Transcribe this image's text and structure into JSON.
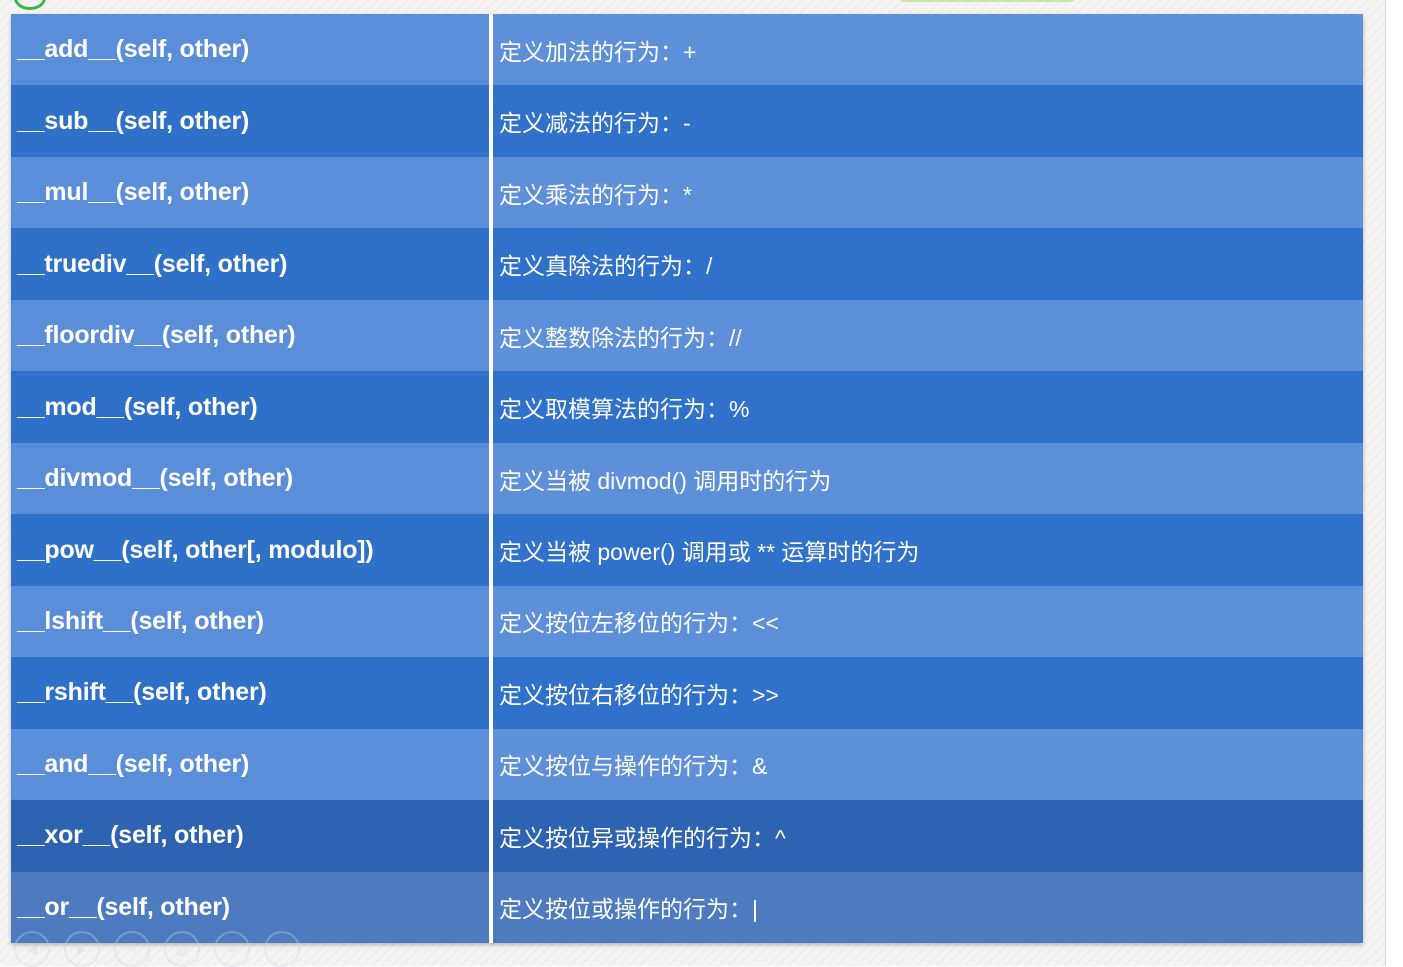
{
  "rows": [
    {
      "name": "__add__(self, other)",
      "desc": "定义加法的行为：+"
    },
    {
      "name": "__sub__(self, other)",
      "desc": "定义减法的行为：-"
    },
    {
      "name": "__mul__(self, other)",
      "desc": "定义乘法的行为：*"
    },
    {
      "name": "__truediv__(self, other)",
      "desc": "定义真除法的行为：/"
    },
    {
      "name": "__floordiv__(self, other)",
      "desc": "定义整数除法的行为：//"
    },
    {
      "name": "__mod__(self, other)",
      "desc": "定义取模算法的行为：%"
    },
    {
      "name": "__divmod__(self, other)",
      "desc": "定义当被 divmod() 调用时的行为"
    },
    {
      "name": "__pow__(self, other[, modulo])",
      "desc": "定义当被 power() 调用或 ** 运算时的行为"
    },
    {
      "name": "__lshift__(self, other)",
      "desc": "定义按位左移位的行为：<<"
    },
    {
      "name": "__rshift__(self, other)",
      "desc": "定义按位右移位的行为：>>"
    },
    {
      "name": "__and__(self, other)",
      "desc": "定义按位与操作的行为：&"
    },
    {
      "name": "__xor__(self, other)",
      "desc": "定义按位异或操作的行为：^"
    },
    {
      "name": "__or__(self, other)",
      "desc": "定义按位或操作的行为：|"
    }
  ],
  "colors": {
    "row_light": "#5e90da",
    "row_dark": "#3072cb",
    "text": "#ffffff"
  },
  "player_controls": [
    "previous-icon",
    "play-icon",
    "pen-icon",
    "slides-icon",
    "zoom-icon",
    "more-icon"
  ]
}
